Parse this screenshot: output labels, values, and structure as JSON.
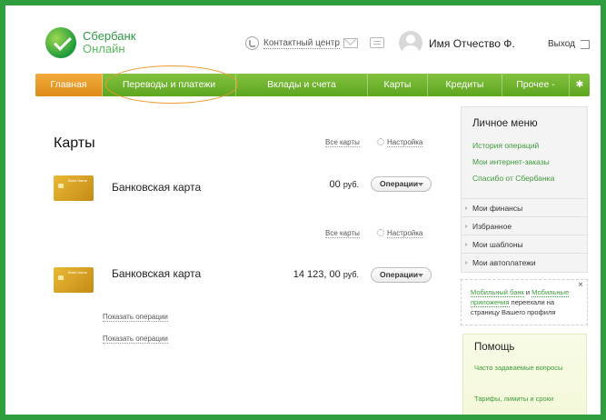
{
  "brand": {
    "line1": "Сбербанк",
    "line2": "Онлайн"
  },
  "header": {
    "contact_label": "Контактный центр",
    "username": "Имя Отчество Ф.",
    "logout_label": "Выход"
  },
  "nav": {
    "items": [
      {
        "label": "Главная"
      },
      {
        "label": "Переводы и платежи"
      },
      {
        "label": "Вклады и счета"
      },
      {
        "label": "Карты"
      },
      {
        "label": "Кредиты"
      },
      {
        "label": "Прочее -"
      }
    ]
  },
  "main": {
    "title": "Карты",
    "all_cards_label": "Все карты",
    "settings_label": "Настройка",
    "cards": [
      {
        "name": "Банковская карта",
        "amount": "00",
        "currency": "руб.",
        "ops_label": "Операции",
        "card_text": "Bank Name"
      },
      {
        "name": "Банковская карта",
        "amount": "14 123, 00",
        "currency": "руб.",
        "ops_label": "Операции",
        "card_text": "Bank Name"
      }
    ],
    "show_ops_label": "Показать операции"
  },
  "side": {
    "title": "Личное меню",
    "links": [
      "История операций",
      "Мои интернет-заказы",
      "Спасибо от Сбербанка"
    ],
    "rows": [
      "Мои финансы",
      "Избранное",
      "Мои шаблоны",
      "Мои автоплатежи"
    ]
  },
  "note": {
    "link1": "Мобильный банк",
    "and": " и ",
    "link2": "Мобильные приложения",
    "text": " переехали на страницу Вашего профиля",
    "close": "×"
  },
  "help": {
    "title": "Помощь",
    "links": [
      "Часто задаваемые вопросы",
      "Тарифы, лимиты и сроки"
    ]
  },
  "colors": {
    "frame": "#2f9e3e",
    "nav_green": "#6aaf29",
    "active_orange": "#e9992b",
    "link_green": "#3d9a3a"
  }
}
